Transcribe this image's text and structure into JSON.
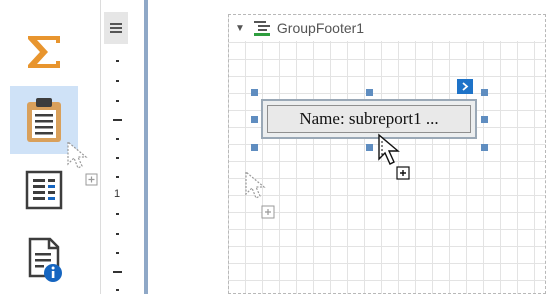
{
  "toolbox": {
    "items": [
      {
        "icon": "summary-sigma-icon",
        "selected": false
      },
      {
        "icon": "subreport-clipboard-icon",
        "selected": true
      },
      {
        "icon": "table-of-contents-icon",
        "selected": false
      },
      {
        "icon": "report-info-icon",
        "selected": false
      }
    ]
  },
  "ruler": {
    "marker": "1"
  },
  "band": {
    "title": "GroupFooter1"
  },
  "control": {
    "text": "Name: subreport1 ..."
  },
  "colors": {
    "accent": "#1e73c8",
    "selection": "#cfe2f7",
    "sigma": "#e8952e",
    "clipboard": "#d9a05b",
    "info": "#1565c0",
    "handle": "#5f8dc0",
    "splitter": "#8fa8c7"
  }
}
